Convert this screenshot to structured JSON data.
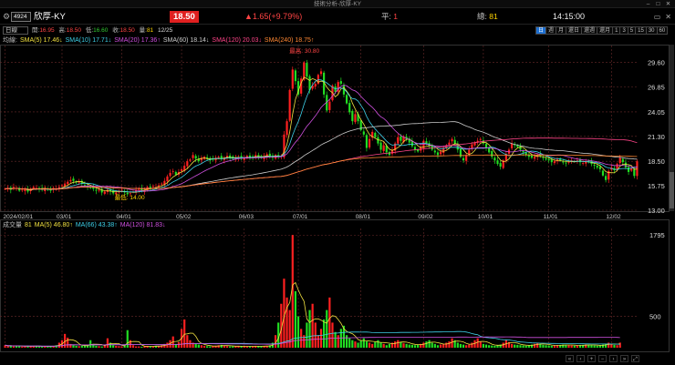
{
  "window": {
    "title": "技術分析-欣厚-KY"
  },
  "header": {
    "code": "4924",
    "name": "欣厚-KY",
    "price": "18.50",
    "change": "▲1.65(+9.79%)",
    "flat_label": "平:",
    "flat_value": "1",
    "total_label": "總:",
    "total_value": "81",
    "time": "14:15:00"
  },
  "stats": {
    "period_select": "日線",
    "open_label": "開:",
    "open": "16.95",
    "high_label": "高:",
    "high": "18.50",
    "low_label": "低:",
    "low": "16.60",
    "close_label": "收:",
    "close": "18.50",
    "vol_label": "量:",
    "vol": "81",
    "date": "12/25"
  },
  "period_tabs": [
    "日",
    "週",
    "月",
    "還日",
    "還週",
    "還月",
    "1",
    "3",
    "5",
    "15",
    "30",
    "60"
  ],
  "price_legend": {
    "label": "均線:",
    "items": [
      {
        "text": "SMA(5) 17.46↓",
        "color": "#f0e040"
      },
      {
        "text": "SMA(10) 17.71↓",
        "color": "#3ed0e8"
      },
      {
        "text": "SMA(20) 17.36↑",
        "color": "#d050e0"
      },
      {
        "text": "SMA(60) 18.14↓",
        "color": "#cccccc"
      },
      {
        "text": "SMA(120) 20.03↓",
        "color": "#ff4488"
      },
      {
        "text": "SMA(240) 18.75↑",
        "color": "#ff8833"
      }
    ]
  },
  "volume_legend": {
    "label": "成交量",
    "value": "81",
    "items": [
      {
        "text": "MA(5) 46.80↑",
        "color": "#f0e040"
      },
      {
        "text": "MA(66) 43.38↑",
        "color": "#3ed0e8"
      },
      {
        "text": "MA(120) 81.83↓",
        "color": "#d050e0"
      }
    ]
  },
  "annotations": {
    "high": "最高: 30.80",
    "low": "最低: 14.00"
  },
  "colors": {
    "up": "#ff2020",
    "down": "#22dd22",
    "bg": "#000000",
    "grid": "#6a2a2a"
  },
  "chart_data": [
    {
      "type": "candlestick",
      "title": "",
      "yticks": [
        13.0,
        15.75,
        18.5,
        21.3,
        24.05,
        26.85,
        29.6
      ],
      "ylim": [
        13.0,
        31.5
      ],
      "xticks": [
        "2024/02/01",
        "03/01",
        "04/01",
        "05/02",
        "06/03",
        "07/01",
        "08/01",
        "09/02",
        "10/01",
        "11/01",
        "12/02"
      ],
      "close": [
        15.4,
        15.5,
        15.3,
        15.6,
        15.5,
        15.2,
        15.3,
        15.4,
        15.1,
        15.3,
        15.6,
        15.5,
        15.4,
        15.3,
        15.5,
        15.3,
        15.2,
        15.5,
        15.4,
        15.6,
        15.8,
        16.0,
        16.2,
        16.4,
        16.3,
        16.1,
        16.2,
        16.0,
        15.8,
        15.6,
        15.5,
        15.4,
        15.2,
        15.3,
        15.0,
        15.1,
        15.3,
        15.1,
        14.9,
        15.0,
        15.2,
        15.3,
        15.0,
        14.8,
        14.9,
        15.1,
        15.3,
        15.4,
        15.2,
        15.3,
        15.6,
        15.5,
        15.7,
        15.6,
        15.8,
        16.0,
        16.3,
        16.8,
        17.2,
        17.4,
        17.0,
        17.3,
        17.6,
        18.0,
        18.5,
        18.7,
        19.2,
        18.8,
        18.5,
        18.9,
        19.0,
        18.8,
        18.6,
        18.7,
        18.9,
        19.0,
        18.8,
        18.9,
        19.1,
        18.9,
        18.8,
        18.9,
        19.0,
        18.8,
        18.9,
        19.1,
        18.9,
        19.0,
        19.2,
        19.0,
        18.9,
        19.1,
        19.3,
        19.0,
        18.9,
        19.2,
        19.0,
        19.1,
        21.5,
        23.0,
        26.5,
        28.8,
        27.5,
        26.0,
        27.8,
        29.6,
        28.0,
        26.5,
        27.0,
        27.2,
        28.2,
        28.6,
        26.0,
        24.2,
        25.2,
        27.0,
        26.3,
        27.4,
        27.2,
        26.0,
        25.0,
        24.0,
        23.0,
        23.8,
        23.0,
        22.0,
        21.5,
        20.0,
        21.0,
        21.8,
        21.2,
        20.5,
        19.8,
        20.3,
        19.5,
        19.2,
        19.8,
        20.5,
        21.2,
        20.8,
        21.3,
        21.0,
        20.6,
        20.2,
        19.8,
        19.6,
        20.1,
        20.8,
        20.5,
        20.2,
        19.8,
        19.5,
        19.2,
        19.6,
        20.0,
        20.3,
        20.6,
        21.0,
        20.5,
        19.8,
        19.0,
        18.6,
        19.2,
        19.8,
        20.4,
        20.6,
        20.8,
        21.0,
        20.5,
        20.0,
        19.5,
        19.0,
        18.6,
        18.2,
        17.9,
        18.6,
        19.3,
        19.8,
        20.5,
        20.3,
        20.1,
        19.8,
        19.5,
        19.2,
        19.0,
        18.9,
        19.0,
        19.2,
        19.1,
        18.9,
        18.7,
        18.6,
        18.4,
        18.5,
        18.7,
        18.6,
        18.4,
        18.3,
        18.4,
        18.6,
        18.5,
        18.6,
        18.4,
        18.3,
        18.5,
        18.4,
        18.2,
        18.0,
        17.8,
        17.6,
        16.9,
        16.4,
        17.4,
        17.8,
        17.5,
        18.2,
        18.9,
        18.4,
        17.8,
        17.3,
        17.7,
        16.85,
        18.5
      ]
    },
    {
      "type": "bar",
      "title": "",
      "yticks": [
        500,
        1795
      ],
      "ylim": [
        0,
        1900
      ],
      "values": [
        40,
        25,
        30,
        20,
        35,
        25,
        18,
        20,
        22,
        25,
        30,
        25,
        20,
        18,
        22,
        20,
        25,
        30,
        40,
        80,
        120,
        220,
        160,
        60,
        40,
        30,
        25,
        30,
        40,
        35,
        120,
        60,
        30,
        25,
        20,
        35,
        150,
        80,
        40,
        30,
        25,
        20,
        30,
        280,
        120,
        40,
        20,
        20,
        15,
        25,
        30,
        20,
        20,
        25,
        30,
        40,
        60,
        80,
        120,
        180,
        60,
        90,
        300,
        450,
        200,
        120,
        80,
        60,
        50,
        40,
        30,
        25,
        20,
        25,
        30,
        40,
        45,
        30,
        25,
        20,
        22,
        25,
        30,
        22,
        20,
        18,
        20,
        25,
        30,
        22,
        20,
        25,
        30,
        40,
        80,
        200,
        400,
        700,
        1100,
        800,
        600,
        1795,
        900,
        500,
        300,
        200,
        400,
        600,
        700,
        400,
        200,
        300,
        450,
        600,
        800,
        400,
        250,
        200,
        300,
        350,
        200,
        150,
        120,
        100,
        80,
        120,
        150,
        100,
        80,
        60,
        90,
        120,
        80,
        60,
        40,
        60,
        80,
        100,
        120,
        90,
        70,
        60,
        50,
        45,
        40,
        50,
        60,
        80,
        100,
        120,
        80,
        60,
        40,
        50,
        60,
        80,
        100,
        150,
        120,
        80,
        60,
        50,
        40,
        50,
        80,
        120,
        150,
        100,
        60,
        50,
        40,
        35,
        30,
        40,
        50,
        80,
        120,
        90,
        60,
        50,
        45,
        40,
        35,
        30,
        40,
        50,
        60,
        80,
        60,
        45,
        40,
        35,
        30,
        35,
        40,
        45,
        50,
        45,
        40,
        35,
        30,
        35,
        40,
        45,
        50,
        45,
        40,
        35,
        30,
        40,
        50,
        60,
        80,
        60,
        45,
        40,
        81
      ]
    }
  ]
}
